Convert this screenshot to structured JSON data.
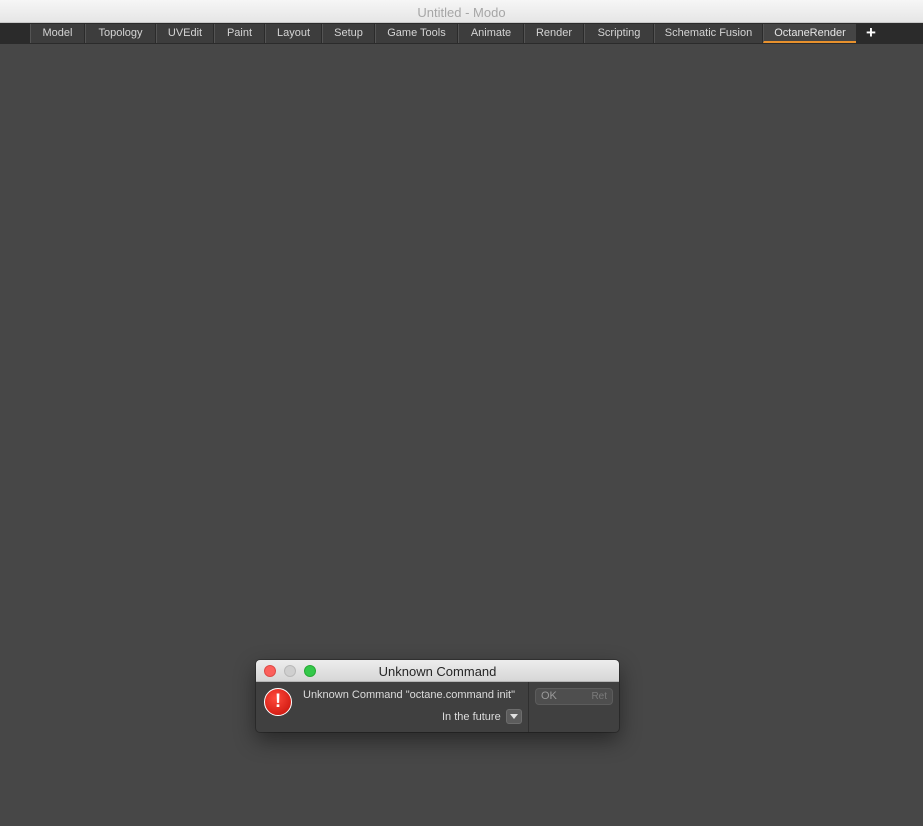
{
  "window": {
    "title": "Untitled - Modo"
  },
  "tabs": [
    {
      "label": "Model"
    },
    {
      "label": "Topology"
    },
    {
      "label": "UVEdit"
    },
    {
      "label": "Paint"
    },
    {
      "label": "Layout"
    },
    {
      "label": "Setup"
    },
    {
      "label": "Game Tools"
    },
    {
      "label": "Animate"
    },
    {
      "label": "Render"
    },
    {
      "label": "Scripting"
    },
    {
      "label": "Schematic Fusion"
    },
    {
      "label": "OctaneRender",
      "active": true
    }
  ],
  "add_tab": {
    "label": "+",
    "icon": "plus-icon"
  },
  "dialog": {
    "title": "Unknown Command",
    "icon": "alert-icon",
    "icon_glyph": "!",
    "message": "Unknown Command \"octane.command init\"",
    "future_label": "In the future",
    "ok_label": "OK",
    "ok_shortcut": "Ret",
    "accent_color": "#e8912d"
  }
}
